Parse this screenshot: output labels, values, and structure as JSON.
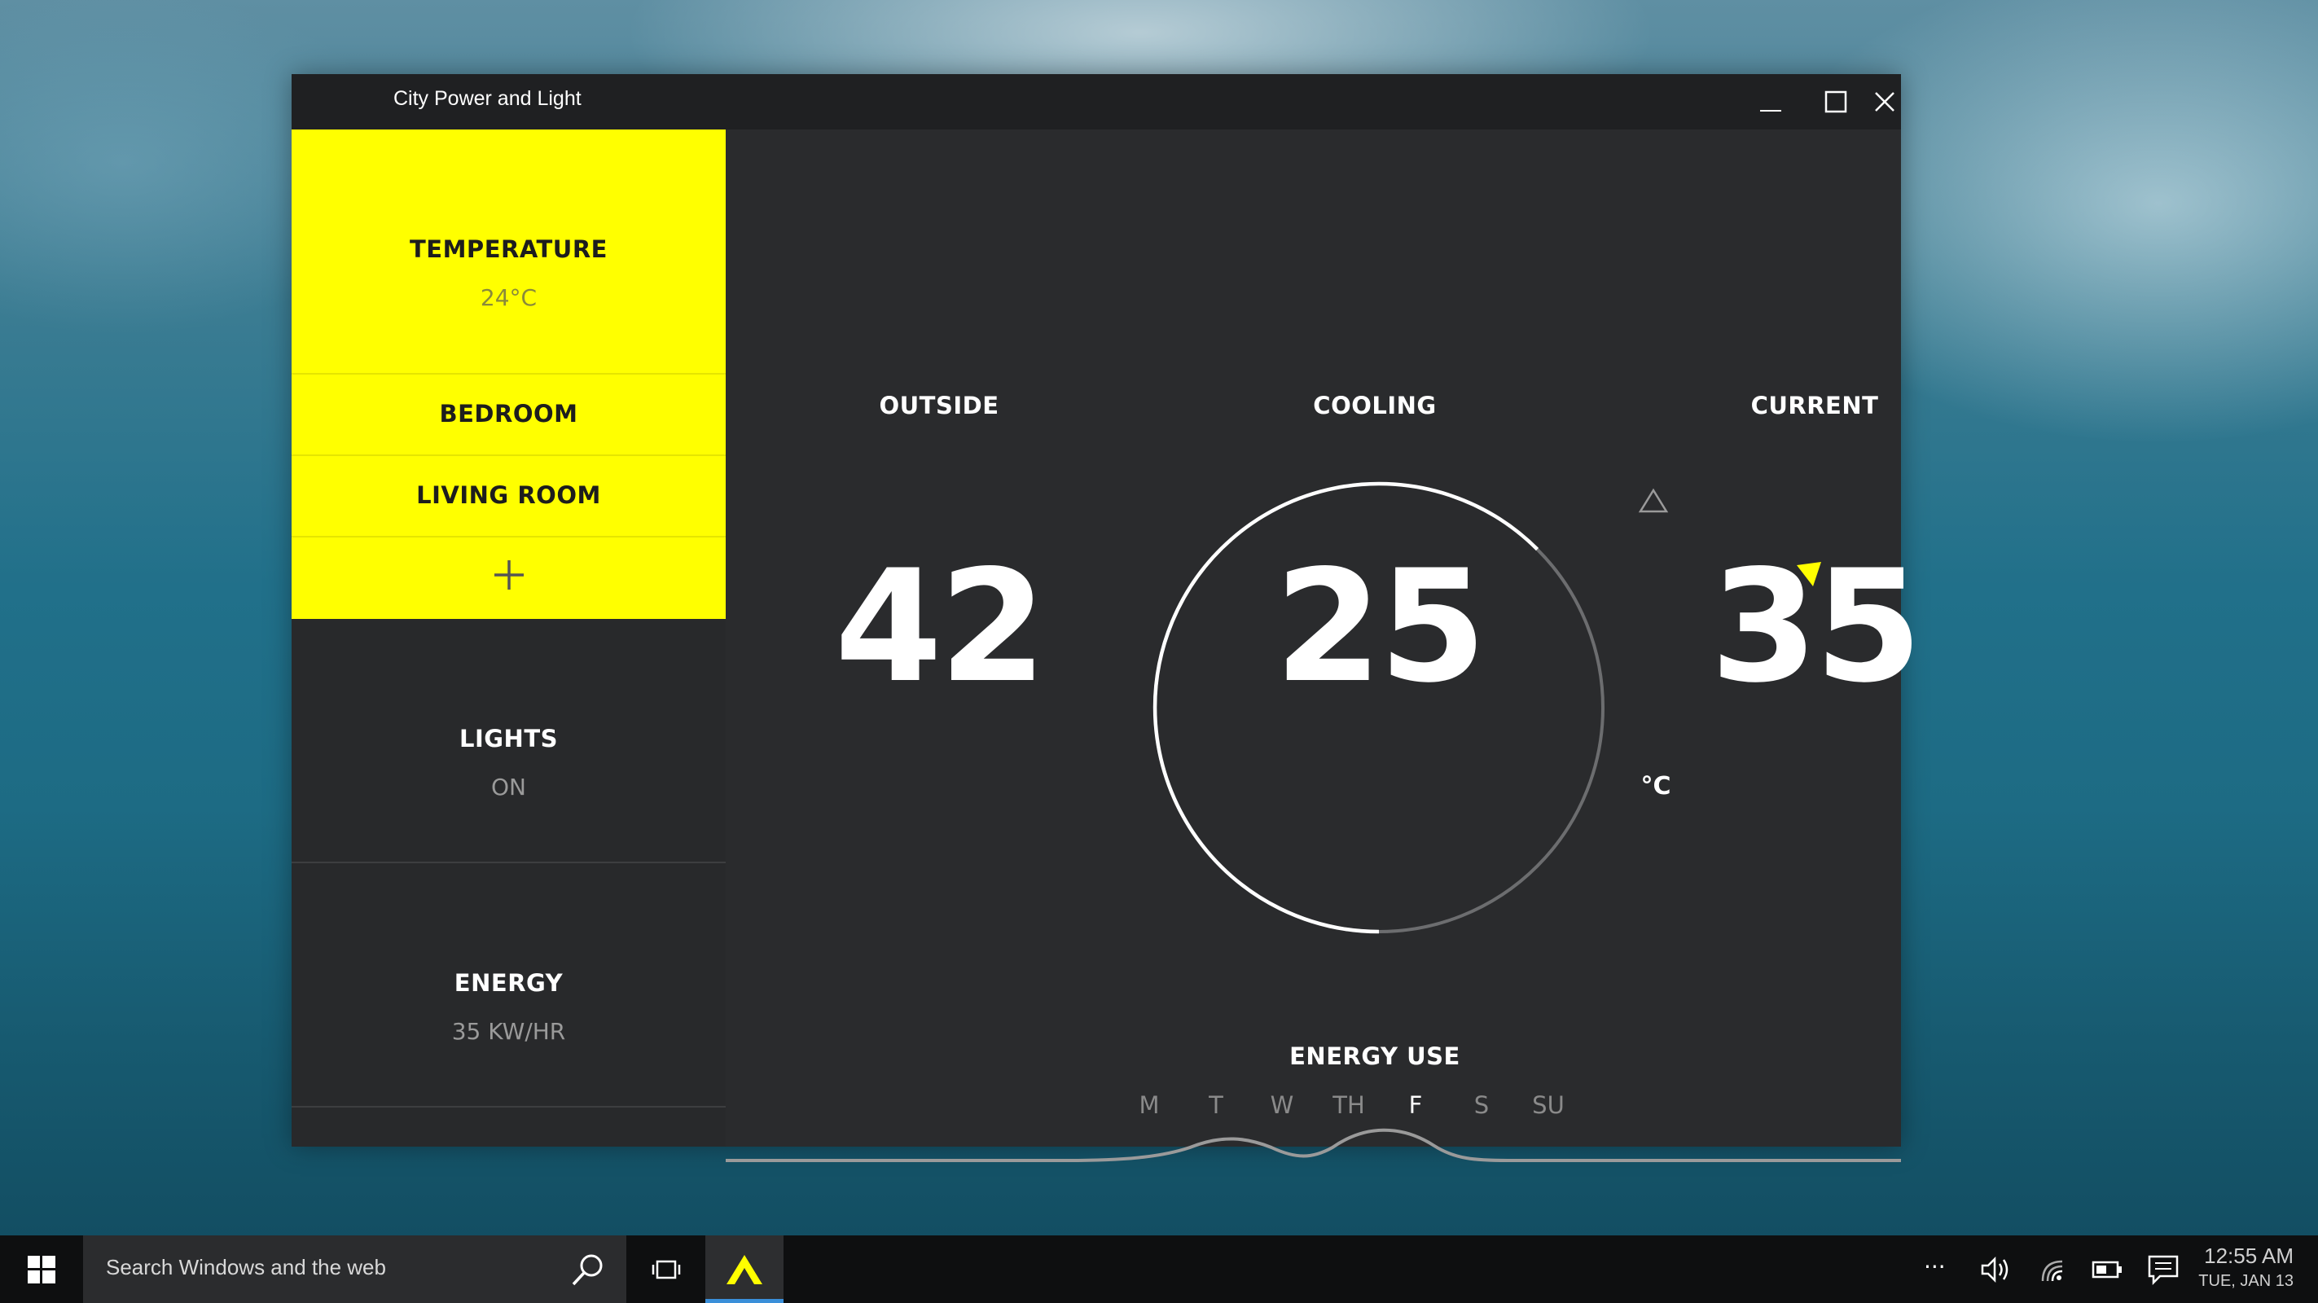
{
  "window": {
    "title": "City Power and Light"
  },
  "sidebar": {
    "items": [
      {
        "label": "TEMPERATURE",
        "value": "24°C"
      },
      {
        "label": "BEDROOM"
      },
      {
        "label": "LIVING ROOM"
      },
      {
        "label": "LIGHTS",
        "value": "ON"
      },
      {
        "label": "ENERGY",
        "value": "35 KW/HR"
      }
    ],
    "add_icon": "plus-icon"
  },
  "main": {
    "outside": {
      "label": "OUTSIDE",
      "value": "42"
    },
    "cooling": {
      "label": "COOLING",
      "value": "25",
      "unit": "°C"
    },
    "current": {
      "label": "CURRENT",
      "value": "35"
    },
    "energy": {
      "label": "ENERGY USE",
      "days": [
        "M",
        "T",
        "W",
        "TH",
        "F",
        "S",
        "SU"
      ],
      "selected_day": "F"
    }
  },
  "taskbar": {
    "search_placeholder": "Search Windows and the web",
    "time": "12:55 AM",
    "date": "TUE, JAN 13"
  },
  "colors": {
    "accent": "#ffff00",
    "window_bg": "#2a2b2d",
    "titlebar_bg": "#1f2022",
    "text": "#ffffff"
  }
}
